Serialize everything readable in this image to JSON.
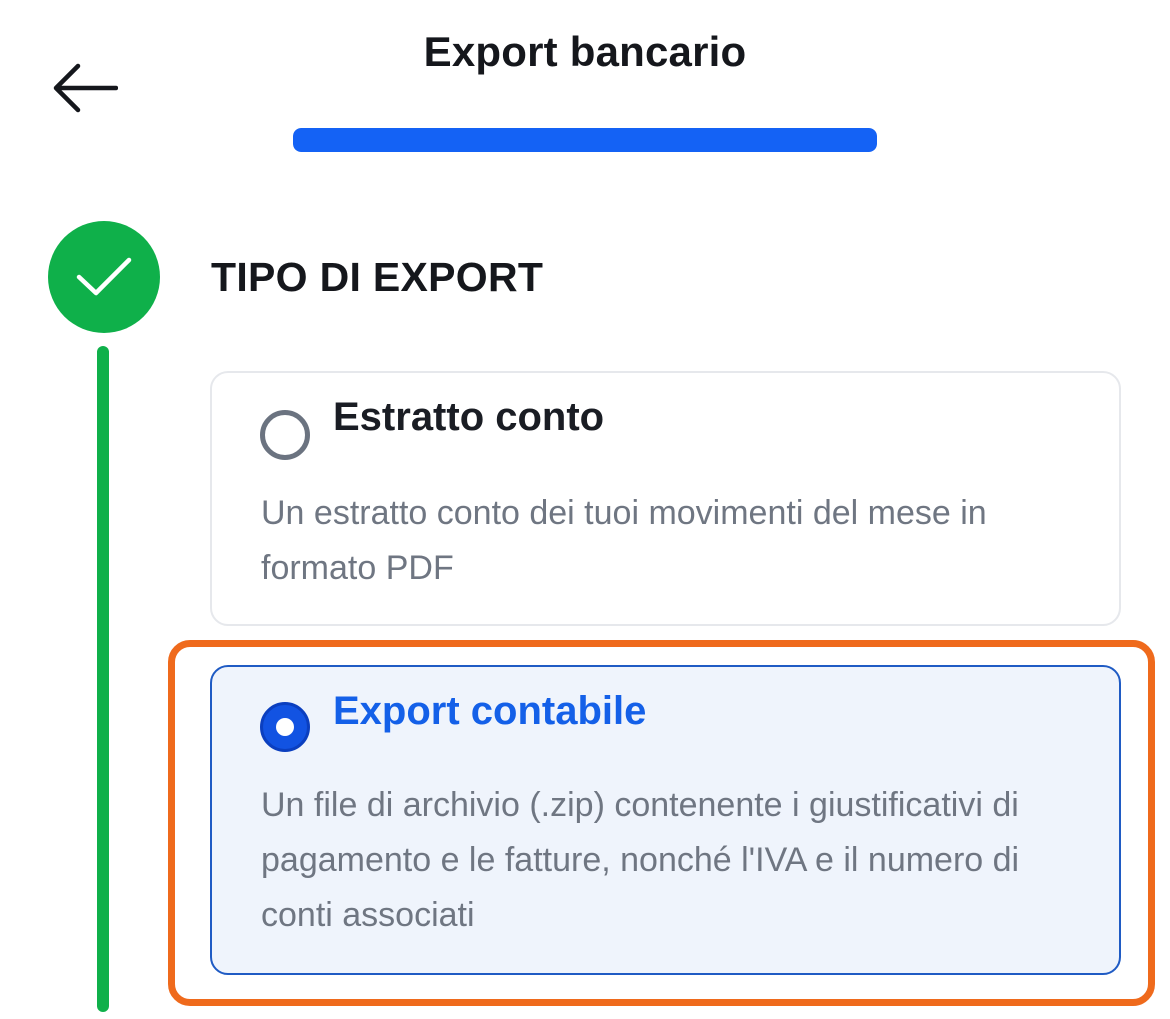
{
  "header": {
    "title": "Export bancario",
    "back_icon": "arrow-left-icon"
  },
  "progress": {
    "value": 1.0,
    "fill_color": "#1462f5"
  },
  "step": {
    "status_icon": "checkmark-icon",
    "status": "completed",
    "color": "#0fb04a",
    "title": "TIPO DI EXPORT"
  },
  "options": [
    {
      "title": "Estratto conto",
      "description": "Un estratto conto dei tuoi movimenti del mese in formato PDF",
      "selected": false
    },
    {
      "title": "Export contabile",
      "description": "Un file di archivio (.zip) contenente i giustificativi di pagamento e le fatture, nonché l'IVA e il numero di conti associati",
      "selected": true,
      "accent_color": "#1460e8"
    }
  ],
  "highlight_color": "#ef6a1c"
}
